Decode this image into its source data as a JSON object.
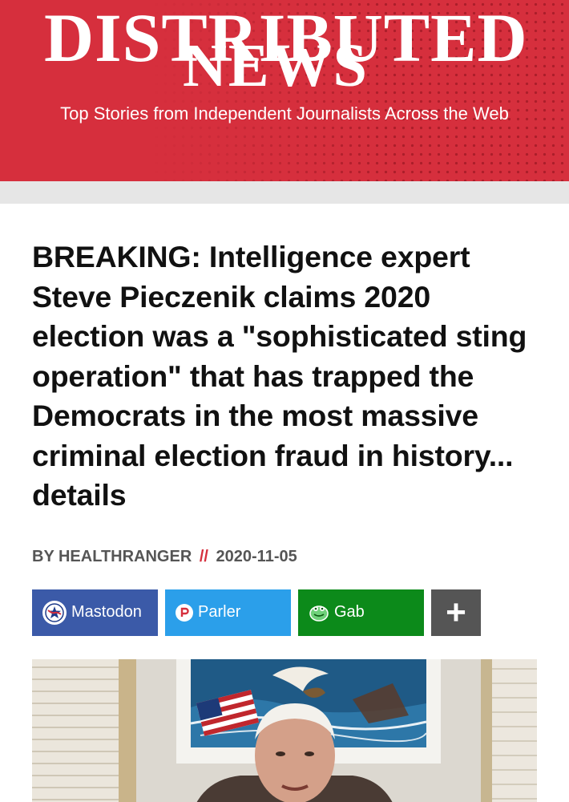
{
  "site": {
    "logo_line1": "DISTRIBUTED",
    "logo_line2": "NEWS",
    "tagline": "Top Stories from Independent Journalists Across the Web"
  },
  "article": {
    "headline": "BREAKING: Intelligence expert Steve Pieczenik claims 2020 election was a \"sophisticated sting operation\" that has trapped the Democrats in the most massive criminal election fraud in history... details",
    "byline_prefix": "BY HEALTHRANGER",
    "byline_separator": "//",
    "date": "2020-11-05"
  },
  "share": {
    "buttons": [
      {
        "label": "Mastodon",
        "icon": "mastodon-icon",
        "color": "#3b5aa8"
      },
      {
        "label": "Parler",
        "icon": "parler-icon",
        "color": "#2b9fea"
      },
      {
        "label": "Gab",
        "icon": "gab-icon",
        "color": "#0c8a1a"
      }
    ],
    "more_label": "+"
  },
  "colors": {
    "brand_red": "#d62f3d",
    "byline_grey": "#555555"
  }
}
